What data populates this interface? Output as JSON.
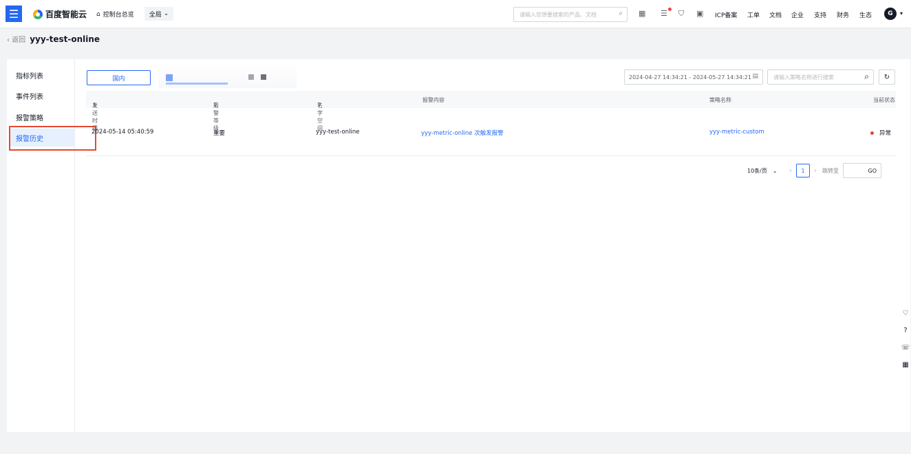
{
  "header": {
    "menu_icon": "hamburger-icon",
    "logo_text": "百度智能云",
    "console_home": "控制台总览",
    "scope": "全局",
    "search_placeholder": "请输入您想要搜索的产品、文档",
    "nav": [
      "ICP备案",
      "工单",
      "文档",
      "企业",
      "支持",
      "财务",
      "生态"
    ],
    "avatar_letter": "G",
    "accent_color": "#2468f2"
  },
  "breadcrumb": {
    "back": "返回",
    "title": "yyy-test-online"
  },
  "sidebar": {
    "items": [
      {
        "label": "指标列表"
      },
      {
        "label": "事件列表"
      },
      {
        "label": "报警策略"
      },
      {
        "label": "报警历史",
        "active": true
      }
    ]
  },
  "toolbar": {
    "region_button": "国内",
    "date_range": "2024-04-27 14:34:21 - 2024-05-27 14:34:21",
    "policy_search_placeholder": "请输入策略名称进行搜索"
  },
  "table": {
    "headers": {
      "send_time": "发送时间",
      "level": "报警等级",
      "namespace": "名字空间",
      "content": "报警内容",
      "policy": "策略名称",
      "status": "当前状态"
    },
    "rows": [
      {
        "send_time": "2024-05-14 05:40:59",
        "level": "重要",
        "namespace": "yyy-test-online",
        "content": "yyy-metric-online 次触发报警",
        "policy": "yyy-metric-custom",
        "status": "异常",
        "status_color": "#e8472f"
      }
    ]
  },
  "pagination": {
    "page_size": "10条/页",
    "current_page": "1",
    "jump_label": "跳转至",
    "go": "GO"
  }
}
